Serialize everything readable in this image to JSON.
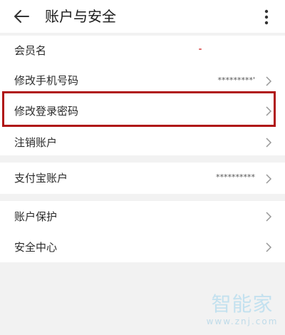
{
  "header": {
    "title": "账户与安全",
    "back_icon": "arrow-left-icon",
    "more_icon": "more-vertical-icon"
  },
  "groups": [
    {
      "rows": [
        {
          "label": "会员名",
          "value": "",
          "chevron": false
        },
        {
          "label": "修改手机号码",
          "value": "*********'",
          "chevron": true
        },
        {
          "label": "修改登录密码",
          "value": "",
          "chevron": true,
          "highlighted": true
        },
        {
          "label": "注销账户",
          "value": "",
          "chevron": true
        }
      ]
    },
    {
      "rows": [
        {
          "label": "支付宝账户",
          "value": "**********",
          "chevron": true
        }
      ]
    },
    {
      "rows": [
        {
          "label": "账户保护",
          "value": "",
          "chevron": true
        },
        {
          "label": "安全中心",
          "value": "",
          "chevron": true
        }
      ]
    }
  ],
  "watermark": {
    "logo": "智能家",
    "url": "www.znj.com"
  },
  "colors": {
    "highlight_border": "#b01515",
    "background": "#f2f2f2",
    "row_background": "#ffffff"
  }
}
